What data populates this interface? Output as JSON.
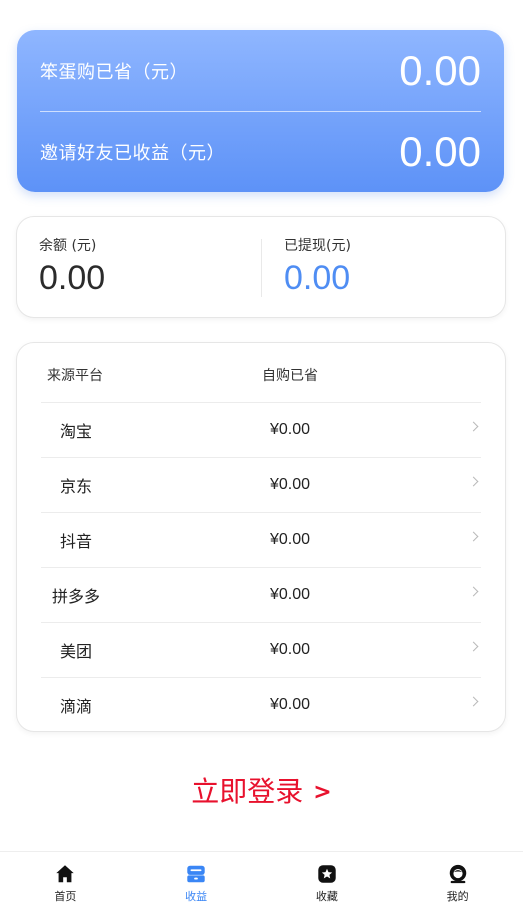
{
  "hero": {
    "saved_label": "笨蛋购已省（元）",
    "saved_value": "0.00",
    "invite_label": "邀请好友已收益（元）",
    "invite_value": "0.00"
  },
  "balance": {
    "balance_label": "余额 (元)",
    "balance_value": "0.00",
    "withdrawn_label": "已提现(元)",
    "withdrawn_value": "0.00"
  },
  "platforms": {
    "header_source": "来源平台",
    "header_saved": "自购已省",
    "rows": [
      {
        "name": "淘宝",
        "amount": "¥0.00"
      },
      {
        "name": "京东",
        "amount": "¥0.00"
      },
      {
        "name": "抖音",
        "amount": "¥0.00"
      },
      {
        "name": "拼多多",
        "amount": "¥0.00"
      },
      {
        "name": "美团",
        "amount": "¥0.00"
      },
      {
        "name": "滴滴",
        "amount": "¥0.00"
      }
    ]
  },
  "login": {
    "label": "立即登录",
    "arrow": ">"
  },
  "tabbar": {
    "items": [
      {
        "label": "首页",
        "icon": "home-icon"
      },
      {
        "label": "收益",
        "icon": "earnings-icon",
        "active": true
      },
      {
        "label": "收藏",
        "icon": "favorite-icon"
      },
      {
        "label": "我的",
        "icon": "profile-icon"
      }
    ]
  },
  "colors": {
    "accent": "#3a86f5",
    "hero_top": "#8fb6ff",
    "hero_bottom": "#5d92f7",
    "login_red": "#e8112d"
  }
}
